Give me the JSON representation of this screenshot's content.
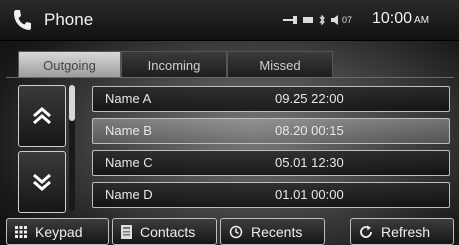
{
  "header": {
    "title": "Phone",
    "time": "10:00",
    "ampm": "AM",
    "status_icons": [
      "signal-icon",
      "battery-icon",
      "bluetooth-icon",
      "volume-icon"
    ],
    "volume_label": "07"
  },
  "tabs": [
    {
      "label": "Outgoing",
      "active": true
    },
    {
      "label": "Incoming",
      "active": false
    },
    {
      "label": "Missed",
      "active": false
    }
  ],
  "calls": [
    {
      "name": "Name A",
      "time": "09.25 22:00",
      "selected": false
    },
    {
      "name": "Name B",
      "time": "08.20 00:15",
      "selected": true
    },
    {
      "name": "Name C",
      "time": "05.01 12:30",
      "selected": false
    },
    {
      "name": "Name D",
      "time": "01.01 00:00",
      "selected": false
    }
  ],
  "buttons": {
    "keypad": "Keypad",
    "contacts": "Contacts",
    "recents": "Recents",
    "refresh": "Refresh"
  },
  "colors": {
    "accent": "#d8d8d8",
    "text": "#e8e8e8"
  }
}
